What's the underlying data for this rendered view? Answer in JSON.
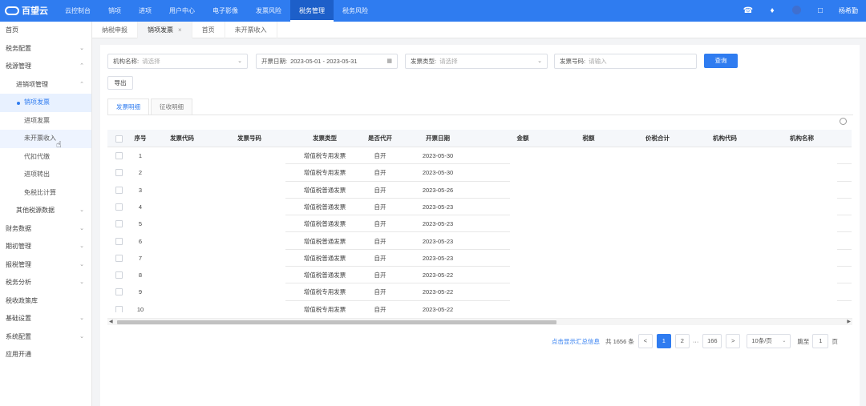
{
  "app": {
    "logo_text": "百望云"
  },
  "topnav": {
    "items": [
      "云控制台",
      "销项",
      "进项",
      "用户中心",
      "电子影像",
      "发票风险",
      "税务管理",
      "税务风险"
    ],
    "active_index": 6
  },
  "topicons": [
    "headset-icon",
    "bell-icon",
    "circle-icon",
    "help-icon"
  ],
  "user": {
    "name": "杨希勤"
  },
  "sidebar": {
    "items": [
      {
        "label": "首页",
        "level": 0
      },
      {
        "label": "税务配置",
        "level": 0,
        "chevron": "down"
      },
      {
        "label": "税源管理",
        "level": 0,
        "chevron": "up"
      },
      {
        "label": "进销项管理",
        "level": 1,
        "chevron": "up"
      },
      {
        "label": "销项发票",
        "level": 2,
        "active": true
      },
      {
        "label": "进项发票",
        "level": 2
      },
      {
        "label": "未开票收入",
        "level": 2,
        "hover": true
      },
      {
        "label": "代扣代缴",
        "level": 2
      },
      {
        "label": "进项转出",
        "level": 2
      },
      {
        "label": "免税比计算",
        "level": 2
      },
      {
        "label": "其他税源数据",
        "level": 1,
        "chevron": "down"
      },
      {
        "label": "财务数据",
        "level": 0,
        "chevron": "down"
      },
      {
        "label": "期初管理",
        "level": 0,
        "chevron": "down"
      },
      {
        "label": "报税管理",
        "level": 0,
        "chevron": "down"
      },
      {
        "label": "税务分析",
        "level": 0,
        "chevron": "down"
      },
      {
        "label": "税收政策库",
        "level": 0
      },
      {
        "label": "基础设置",
        "level": 0,
        "chevron": "down"
      },
      {
        "label": "系统配置",
        "level": 0,
        "chevron": "down"
      },
      {
        "label": "应用开通",
        "level": 0
      }
    ]
  },
  "page_tabs": [
    {
      "label": "纳税申报",
      "closable": false
    },
    {
      "label": "销项发票",
      "closable": true,
      "active": true
    },
    {
      "label": "首页",
      "closable": false
    },
    {
      "label": "未开票收入",
      "closable": false
    }
  ],
  "filters": {
    "org": {
      "label": "机构名称:",
      "placeholder": "请选择"
    },
    "date": {
      "label": "开票日期:",
      "value": "2023-05-01 - 2023-05-31"
    },
    "type": {
      "label": "发票类型:",
      "placeholder": "请选择"
    },
    "number": {
      "label": "发票号码:",
      "placeholder": "请输入"
    },
    "query_label": "查询",
    "export_label": "导出"
  },
  "subtabs": [
    "发票明细",
    "征收明细"
  ],
  "table": {
    "columns": [
      "序号",
      "发票代码",
      "发票号码",
      "发票类型",
      "是否代开",
      "开票日期",
      "金额",
      "税额",
      "价税合计",
      "机构代码",
      "机构名称"
    ],
    "rows": [
      [
        "1",
        "",
        "",
        "增值税专用发票",
        "自开",
        "2023-05-30",
        "",
        "",
        "",
        "",
        ""
      ],
      [
        "2",
        "",
        "",
        "增值税专用发票",
        "自开",
        "2023-05-30",
        "",
        "",
        "",
        "",
        ""
      ],
      [
        "3",
        "",
        "",
        "增值税普通发票",
        "自开",
        "2023-05-26",
        "",
        "",
        "",
        "",
        ""
      ],
      [
        "4",
        "",
        "",
        "增值税普通发票",
        "自开",
        "2023-05-23",
        "",
        "",
        "",
        "",
        ""
      ],
      [
        "5",
        "",
        "",
        "增值税普通发票",
        "自开",
        "2023-05-23",
        "",
        "",
        "",
        "",
        ""
      ],
      [
        "6",
        "",
        "",
        "增值税普通发票",
        "自开",
        "2023-05-23",
        "",
        "",
        "",
        "",
        ""
      ],
      [
        "7",
        "",
        "",
        "增值税普通发票",
        "自开",
        "2023-05-23",
        "",
        "",
        "",
        "",
        ""
      ],
      [
        "8",
        "",
        "",
        "增值税普通发票",
        "自开",
        "2023-05-22",
        "",
        "",
        "",
        "",
        ""
      ],
      [
        "9",
        "",
        "",
        "增值税专用发票",
        "自开",
        "2023-05-22",
        "",
        "",
        "",
        "",
        ""
      ],
      [
        "10",
        "",
        "",
        "增值税专用发票",
        "自开",
        "2023-05-22",
        "",
        "",
        "",
        "",
        ""
      ]
    ]
  },
  "pagination": {
    "summary_link": "点击显示汇总信息",
    "total_text": "共 1656 条",
    "pages": [
      "1",
      "2",
      "···",
      "166"
    ],
    "page_size": "10条/页",
    "jump_label": "跳至",
    "jump_value": "1",
    "page_unit": "页"
  },
  "colors": {
    "primary": "#2f7cf0",
    "header_bg": "#2f7cf0"
  }
}
